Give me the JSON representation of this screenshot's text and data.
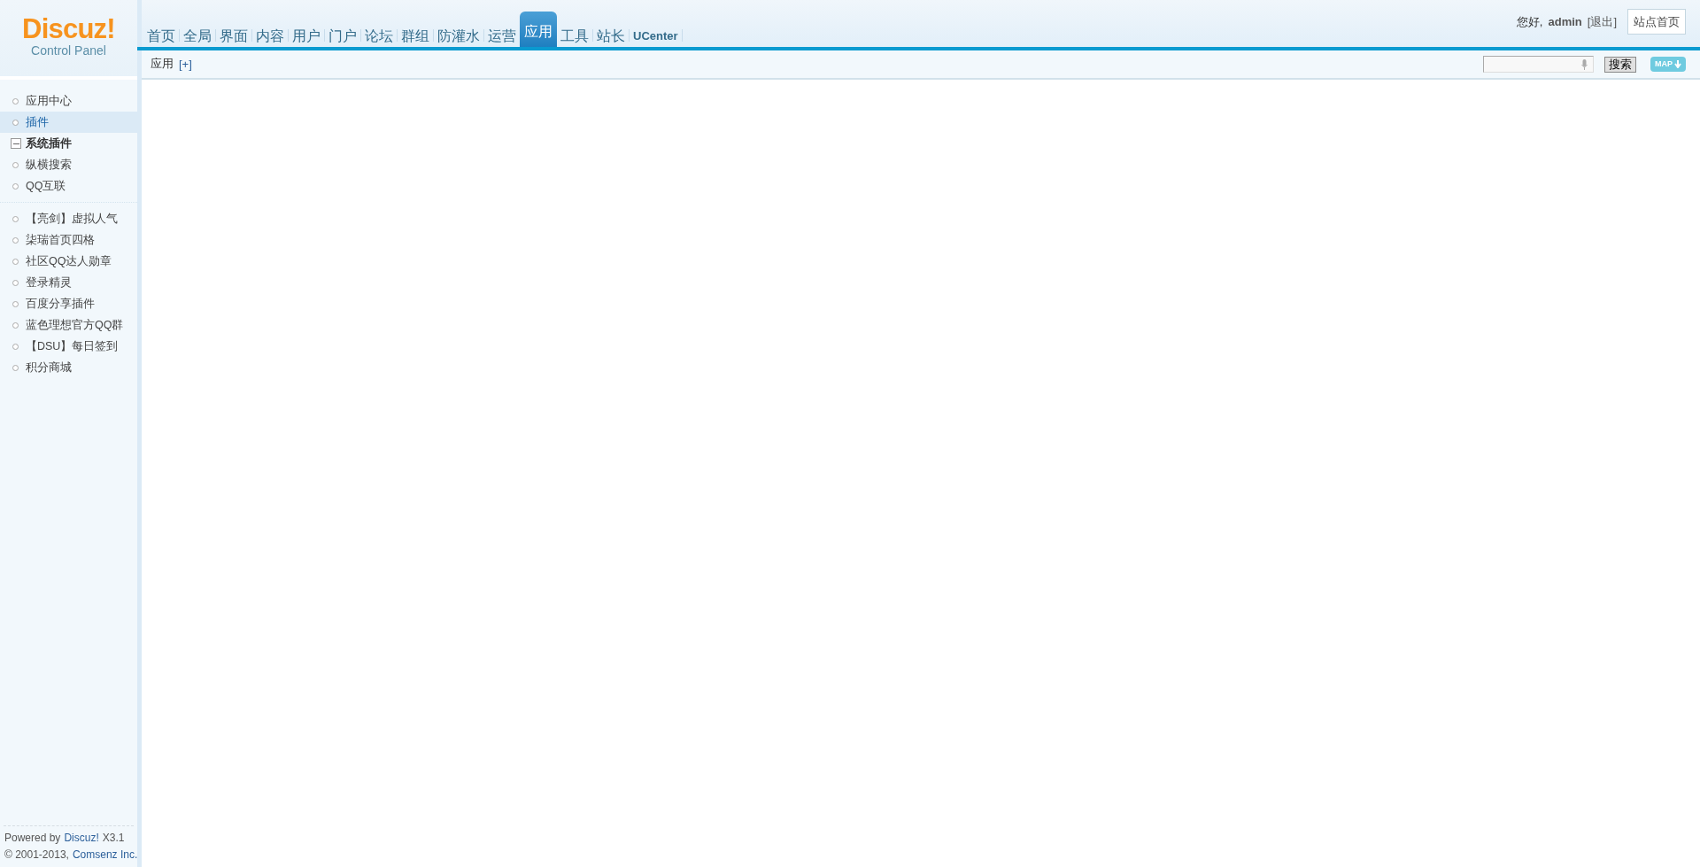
{
  "logo": {
    "name": "Discuz!",
    "subtitle": "Control Panel"
  },
  "nav": [
    {
      "label": "首页",
      "selected": false
    },
    {
      "label": "全局",
      "selected": false
    },
    {
      "label": "界面",
      "selected": false
    },
    {
      "label": "内容",
      "selected": false
    },
    {
      "label": "用户",
      "selected": false
    },
    {
      "label": "门户",
      "selected": false
    },
    {
      "label": "论坛",
      "selected": false
    },
    {
      "label": "群组",
      "selected": false
    },
    {
      "label": "防灌水",
      "selected": false
    },
    {
      "label": "运营",
      "selected": false
    },
    {
      "label": "应用",
      "selected": true
    },
    {
      "label": "工具",
      "selected": false
    },
    {
      "label": "站长",
      "selected": false
    },
    {
      "label": "UCenter",
      "selected": false
    }
  ],
  "user": {
    "greeting": "您好,",
    "name": "admin",
    "logout": "[退出]",
    "home_button": "站点首页"
  },
  "breadcrumb": {
    "title": "应用",
    "add": "[+]"
  },
  "search": {
    "button": "搜索",
    "map": "MAP"
  },
  "sidebar": [
    {
      "items": [
        {
          "label": "应用中心",
          "selected": false
        },
        {
          "label": "插件",
          "selected": true
        }
      ]
    },
    {
      "title": "系统插件",
      "expanded": true,
      "items": [
        {
          "label": "纵横搜索",
          "selected": false
        },
        {
          "label": "QQ互联",
          "selected": false
        }
      ]
    },
    {
      "items": [
        {
          "label": "【亮剑】虚拟人气",
          "selected": false
        },
        {
          "label": "柒瑞首页四格",
          "selected": false
        },
        {
          "label": "社区QQ达人勋章",
          "selected": false
        },
        {
          "label": "登录精灵",
          "selected": false
        },
        {
          "label": "百度分享插件",
          "selected": false
        },
        {
          "label": "蓝色理想官方QQ群",
          "selected": false
        },
        {
          "label": "【DSU】每日签到",
          "selected": false
        },
        {
          "label": "积分商城",
          "selected": false
        }
      ]
    }
  ],
  "footer": [
    {
      "before": "Powered by",
      "link": "Discuz!",
      "after": "X3.1"
    },
    {
      "before": "© 2001-2013,",
      "link": "Comsenz Inc."
    }
  ]
}
